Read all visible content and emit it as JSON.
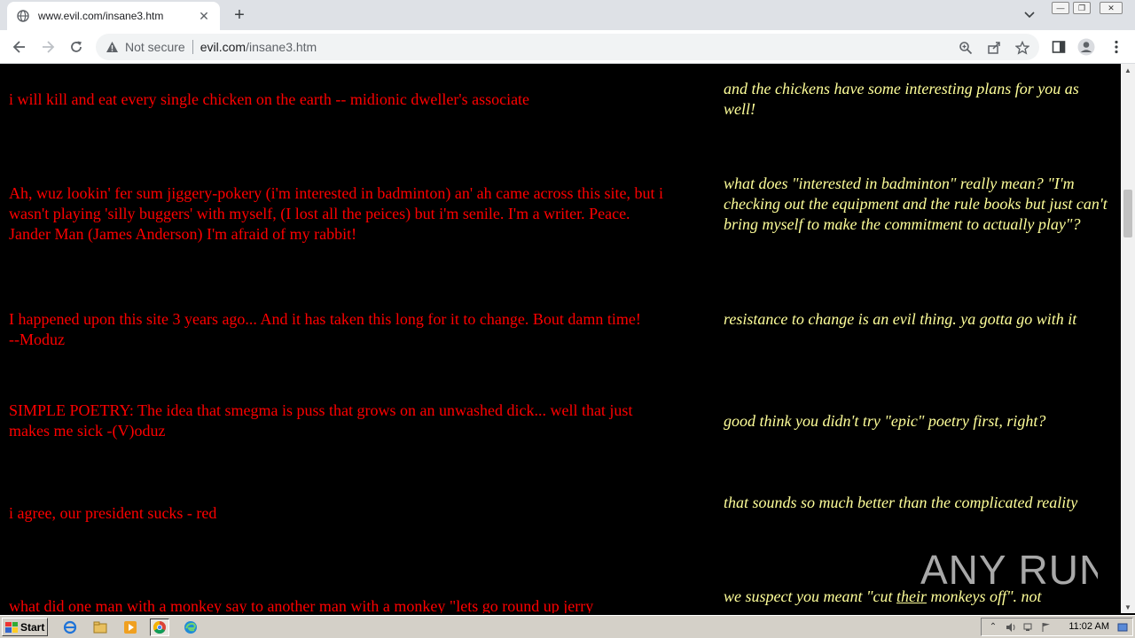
{
  "browser": {
    "tab_title": "www.evil.com/insane3.htm",
    "security_label": "Not secure",
    "url_domain": "evil.com",
    "url_path": "/insane3.htm"
  },
  "entries": [
    {
      "comment": "i will kill and eat every single chicken on  the earth -- midionic dweller's associate",
      "reply": "and the chickens have some interesting plans for you as well!"
    },
    {
      "comment": "Ah, wuz lookin' fer sum jiggery-pokery (i'm interested in badminton) an' ah came across this site, but i wasn't playing 'silly buggers' with myself, (I lost all the peices) but i'm senile. I'm a writer. Peace. Jander Man (James Anderson) I'm afraid of my rabbit!",
      "reply": "what does \"interested in badminton\" really mean? \"I'm checking out the equipment and the rule books but just can't bring myself to make the commitment to actually play\"?"
    },
    {
      "comment": "I happened upon this site 3 years ago...   And it has taken this long for it to change.   Bout damn time!   --Moduz",
      "reply": "resistance to change is an evil thing.  ya gotta go with it"
    },
    {
      "comment": "SIMPLE POETRY:  The idea that smegma is puss that grows on an unwashed dick...  well that just makes me sick    -(V)oduz",
      "reply": "good think you didn't try \"epic\" poetry first, right?"
    },
    {
      "comment": "i agree, our president sucks - red",
      "reply": "that sounds so much better than the complicated reality"
    },
    {
      "comment": "what did one man with a monkey say to another man with a monkey \"lets go round up jerry",
      "reply_before": "we suspect you meant \"cut ",
      "reply_underlined": "their",
      "reply_after": " monkeys off\".  not"
    }
  ],
  "watermark": "ANY RUN",
  "taskbar": {
    "start_label": "Start",
    "clock": "11:02 AM"
  },
  "colors": {
    "comment_text": "#ff0000",
    "reply_text": "#ffff99",
    "page_background": "#000000"
  }
}
